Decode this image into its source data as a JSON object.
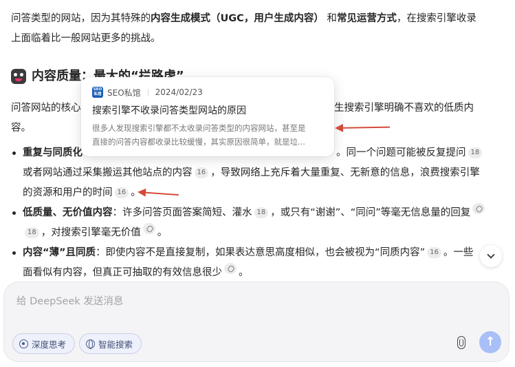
{
  "intro": {
    "t1": "问答类型的网站，因为其特殊的",
    "b1": "内容生成模式（UGC，用户生成内容）",
    "t2": " 和",
    "b2": "常见运营方式",
    "t3": "，在搜索引擎收录",
    "line2": "上面临着比一般网站更多的挑战。"
  },
  "heading": {
    "label": "内容质量：最大的“拦路虎”"
  },
  "para2": {
    "left": "问答网站的核心",
    "right": "产生搜索引擎明确不喜欢的低质内",
    "line2": "容。"
  },
  "bullets": [
    {
      "bold": "重复与同质化",
      "rest_visible": "。同一个问题可能被反复提问",
      "cite1": "18",
      "line2a": "或者网站通过采集搬运其他站点的内容",
      "cite2": "16",
      "line2b": "，导致网络上充斥着大量重复、无新意的信息，浪费搜索引擎",
      "line3": "的资源和用户的时间",
      "cite3": "16",
      "end": "。"
    },
    {
      "bold": "低质量、无价值内容",
      "text1": "：许多问答页面答案简短、灌水",
      "cite1": "18",
      "text2": "，或只有“谢谢”、“同问”等毫无信息量的回复",
      "cite2": "18",
      "text3": "，对搜索引擎毫无价值",
      "end": "。"
    },
    {
      "bold": "内容“薄”且同质",
      "text1": "：即使内容不是直接复制，如果表达意思高度相似，也会被视为“同质内容”",
      "cite1": "16",
      "text2": "。一些",
      "line2": "面看似有内容，但真正可抽取的有效信息很少",
      "end": "。"
    }
  ],
  "popup": {
    "source": "SEO私馆",
    "logo_text": "SEO私馆",
    "date": "2024/02/23",
    "title": "搜索引擎不收录问答类型网站的原因",
    "snippet_line1": "很多人发现搜索引擎都不太收录问答类型的内容网站，甚至是",
    "snippet_line2": "直接的问答内容都收录比较缓慢，其实原因很简单，就是垃..."
  },
  "input": {
    "placeholder": "给 DeepSeek 发送消息",
    "deep_think": "深度思考",
    "web_search": "智能搜索"
  },
  "colors": {
    "arrow": "#d44a3a",
    "send": "#a8bff7",
    "tool_border": "#c9cfe3"
  }
}
